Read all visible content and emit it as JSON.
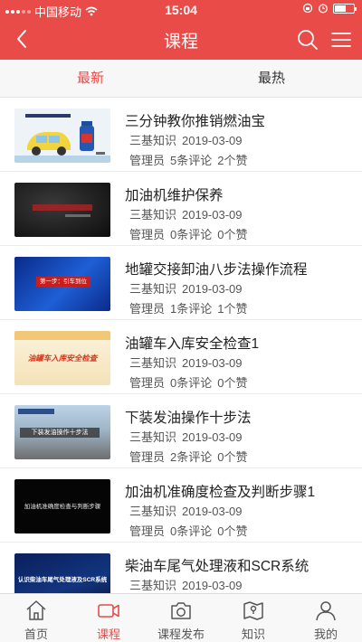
{
  "status_bar": {
    "carrier": "中国移动",
    "time": "15:04"
  },
  "nav": {
    "title": "课程",
    "back_icon": "chevron-left-icon",
    "search_icon": "search-icon",
    "menu_icon": "menu-icon"
  },
  "tabs": [
    {
      "label": "最新",
      "active": true
    },
    {
      "label": "最热",
      "active": false
    }
  ],
  "courses": [
    {
      "title": "三分钟教你推销燃油宝",
      "category": "三基知识",
      "date": "2019-03-09",
      "author": "管理员",
      "comments": "5条评论",
      "likes": "2个赞",
      "thumb_caption": ""
    },
    {
      "title": "加油机维护保养",
      "category": "三基知识",
      "date": "2019-03-09",
      "author": "管理员",
      "comments": "0条评论",
      "likes": "0个赞",
      "thumb_caption": ""
    },
    {
      "title": "地罐交接卸油八步法操作流程",
      "category": "三基知识",
      "date": "2019-03-09",
      "author": "管理员",
      "comments": "1条评论",
      "likes": "1个赞",
      "thumb_caption": "第一步：引车到位"
    },
    {
      "title": "油罐车入库安全检查1",
      "category": "三基知识",
      "date": "2019-03-09",
      "author": "管理员",
      "comments": "0条评论",
      "likes": "0个赞",
      "thumb_caption": "油罐车入库安全检查"
    },
    {
      "title": "下装发油操作十步法",
      "category": "三基知识",
      "date": "2019-03-09",
      "author": "管理员",
      "comments": "2条评论",
      "likes": "0个赞",
      "thumb_caption": "下装发油操作十步法"
    },
    {
      "title": "加油机准确度检查及判断步骤1",
      "category": "三基知识",
      "date": "2019-03-09",
      "author": "管理员",
      "comments": "0条评论",
      "likes": "0个赞",
      "thumb_caption": "加油机准确度检查与判断步骤"
    },
    {
      "title": "柴油车尾气处理液和SCR系统",
      "category": "三基知识",
      "date": "2019-03-09",
      "author": "",
      "comments": "",
      "likes": "",
      "thumb_caption": "认识柴油车尾气处理液及SCR系统"
    }
  ],
  "tabbar": [
    {
      "label": "首页",
      "icon": "home-icon",
      "active": false
    },
    {
      "label": "课程",
      "icon": "video-icon",
      "active": true
    },
    {
      "label": "课程发布",
      "icon": "camera-icon",
      "active": false
    },
    {
      "label": "知识",
      "icon": "map-icon",
      "active": false
    },
    {
      "label": "我的",
      "icon": "user-icon",
      "active": false
    }
  ],
  "colors": {
    "accent": "#e94b49",
    "text": "#222222",
    "meta": "#555555"
  }
}
